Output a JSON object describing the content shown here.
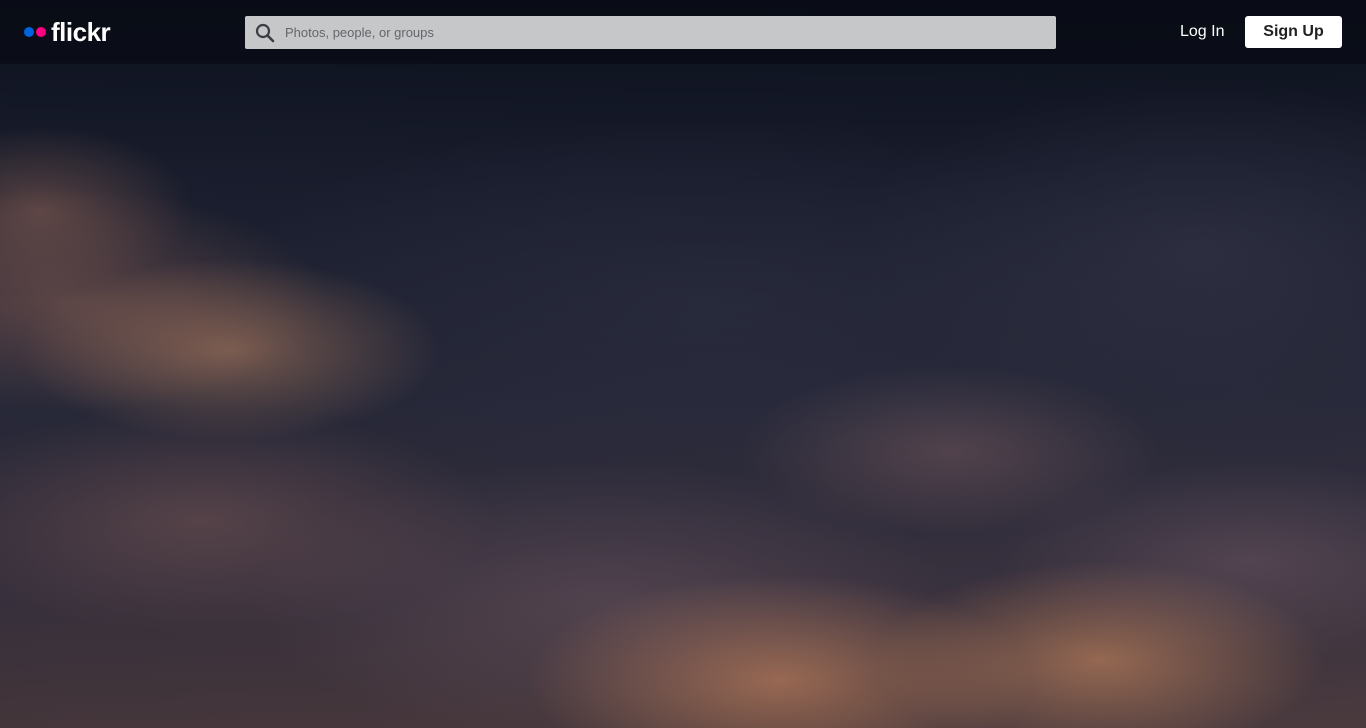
{
  "header": {
    "logo_text": "flickr",
    "search": {
      "placeholder": "Photos, people, or groups",
      "value": ""
    },
    "login_label": "Log In",
    "signup_label": "Sign Up"
  },
  "icons": {
    "logo_dots": [
      "logo-dot-blue",
      "logo-dot-pink"
    ],
    "search": "search-icon"
  },
  "colors": {
    "brand_blue": "#0063dc",
    "brand_pink": "#ff0084",
    "search_bg": "#c6c7c9",
    "signup_bg": "#ffffff"
  }
}
